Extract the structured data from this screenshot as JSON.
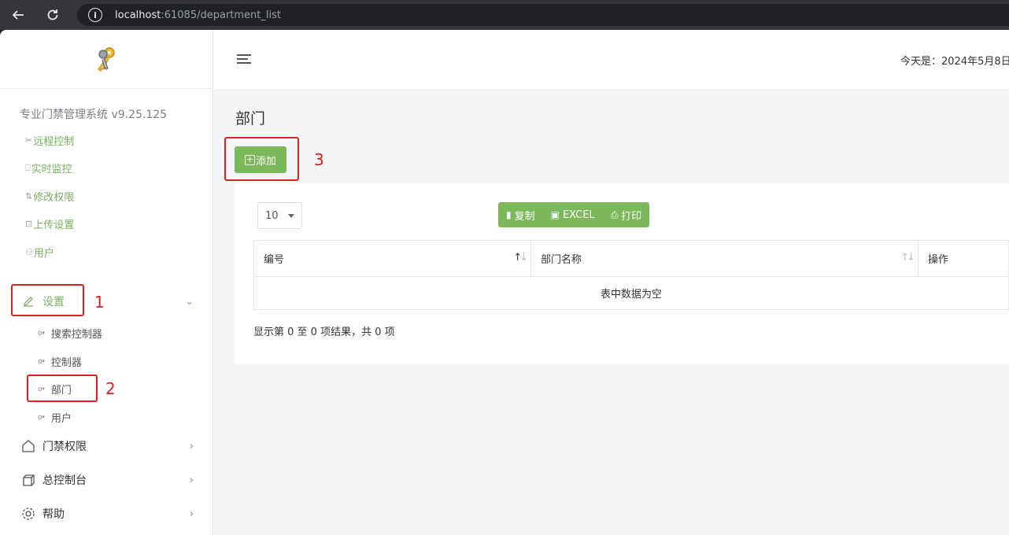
{
  "browser": {
    "url_host": "localhost",
    "url_rest": ":61085/department_list"
  },
  "sidebar": {
    "system_title": "专业门禁管理系统 v9.25.125",
    "quick_links": [
      {
        "icon": "✂",
        "label": "远程控制"
      },
      {
        "icon": "⎕",
        "label": "实时监控"
      },
      {
        "icon": "⇅",
        "label": "修改权限"
      },
      {
        "icon": "⊡",
        "label": "上传设置"
      },
      {
        "icon": "⚇",
        "label": "用户"
      }
    ],
    "settings": {
      "label": "设置",
      "arrow": "⌄"
    },
    "settings_children": [
      "搜索控制器",
      "控制器",
      "部门",
      "用户"
    ],
    "groups": [
      {
        "label": "门禁权限",
        "arrow": "›"
      },
      {
        "label": "总控制台",
        "arrow": "›"
      },
      {
        "label": "帮助",
        "arrow": "›"
      }
    ]
  },
  "annotations": [
    "1",
    "2",
    "3"
  ],
  "topbar": {
    "date": "今天是：2024年5月8日"
  },
  "page": {
    "title": "部门",
    "add_button": "添加",
    "length_value": "10",
    "buttons": {
      "copy": "复制",
      "excel": "EXCEL",
      "print": "打印"
    },
    "table": {
      "headers": [
        "编号",
        "部门名称",
        "操作"
      ],
      "empty_text": "表中数据为空"
    },
    "info": "显示第 0 至 0 项结果，共 0 项"
  },
  "colors": {
    "accent": "#7ab85a",
    "annotation": "#e02020"
  }
}
